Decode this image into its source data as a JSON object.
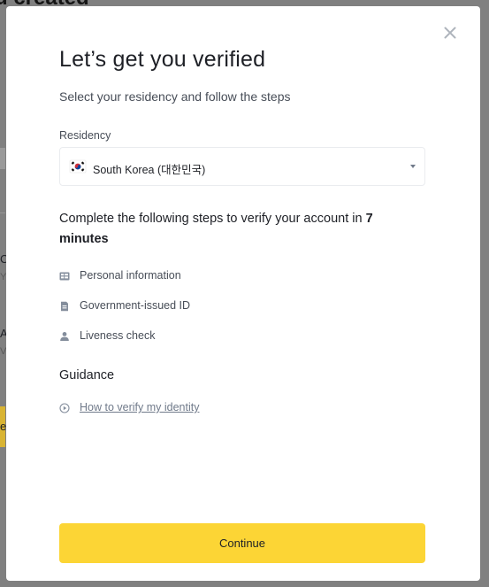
{
  "background": {
    "title_fragment": "u created",
    "fragments": [
      "C",
      "Y",
      "A",
      "V",
      "er"
    ]
  },
  "modal": {
    "close_icon": "close-icon",
    "title": "Let’s get you verified",
    "subtitle": "Select your residency and follow the steps",
    "residency": {
      "label": "Residency",
      "selected_value": "South Korea (대한민국)",
      "flag_icon": "south-korea-flag-icon"
    },
    "steps_intro": "Complete the following steps to verify your account in ",
    "steps_time": "7 minutes",
    "steps": [
      {
        "icon": "id-card-icon",
        "label": "Personal information"
      },
      {
        "icon": "document-icon",
        "label": "Government-issued ID"
      },
      {
        "icon": "person-icon",
        "label": "Liveness check"
      }
    ],
    "guidance": {
      "title": "Guidance",
      "link_icon": "play-circle-icon",
      "link_label": "How to verify my identity"
    },
    "continue_label": "Continue"
  },
  "colors": {
    "primary_yellow": "#fcd535",
    "text_primary": "#1e2026",
    "text_secondary": "#474d57",
    "icon_gray": "#707a8a",
    "overlay": "#808080"
  }
}
